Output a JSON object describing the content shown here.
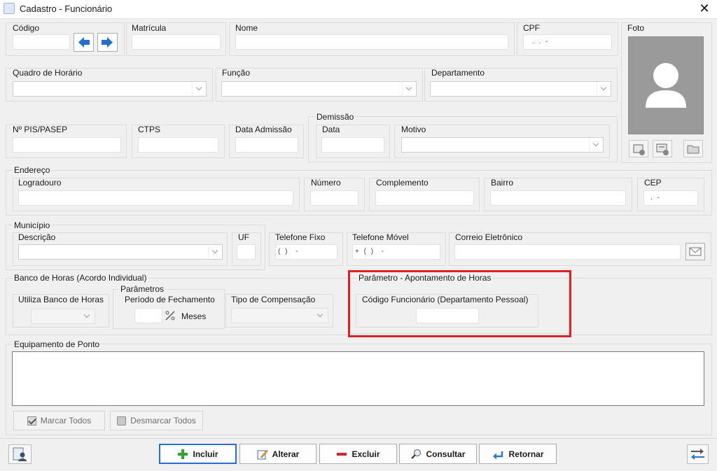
{
  "window": {
    "title": "Cadastro - Funcionário",
    "close_glyph": "✕"
  },
  "labels": {
    "codigo": "Código",
    "matricula": "Matrícula",
    "nome": "Nome",
    "cpf": "CPF",
    "foto": "Foto",
    "quadro_horario": "Quadro de Horário",
    "funcao": "Função",
    "departamento": "Departamento",
    "demissao": "Demissão",
    "pis": "Nº PIS/PASEP",
    "ctps": "CTPS",
    "data_admissao": "Data Admissão",
    "data": "Data",
    "motivo": "Motivo",
    "endereco": "Endereço",
    "logradouro": "Logradouro",
    "numero": "Número",
    "complemento": "Complemento",
    "bairro": "Bairro",
    "cep": "CEP",
    "municipio": "Município",
    "descricao": "Descrição",
    "uf": "UF",
    "telefone_fixo": "Telefone Fixo",
    "telefone_movel": "Telefone Móvel",
    "correio": "Correio Eletrônico",
    "banco_horas": "Banco de Horas (Acordo Individual)",
    "utiliza_banco": "Utiliza Banco de Horas",
    "parametros": "Parâmetros",
    "periodo_fechamento": "Período de Fechamento",
    "meses": "Meses",
    "tipo_compensacao": "Tipo de Compensação",
    "param_apontamento": "Parâmetro - Apontamento de Horas",
    "codigo_funcionario": "Código Funcionário (Departamento Pessoal)",
    "equipamento_ponto": "Equipamento de Ponto"
  },
  "masks": {
    "cpf": ". . -",
    "cep": ". -",
    "telefone_fixo": "( )  -",
    "telefone_movel": "+ ( )  -"
  },
  "selection_buttons": {
    "marcar_todos": "Marcar Todos",
    "desmarcar_todos": "Desmarcar Todos"
  },
  "toolbar": {
    "incluir": "Incluir",
    "alterar": "Alterar",
    "excluir": "Excluir",
    "consultar": "Consultar",
    "retornar": "Retornar"
  },
  "icons": {
    "prev": "arrow-left-icon",
    "next": "arrow-right-icon",
    "photo": "user-silhouette-icon",
    "email": "envelope-icon"
  },
  "colors": {
    "highlight": "#e02020",
    "arrow_blue": "#1f6fd6",
    "incluir_green": "#2fa52f",
    "excluir_red": "#d9232e"
  }
}
